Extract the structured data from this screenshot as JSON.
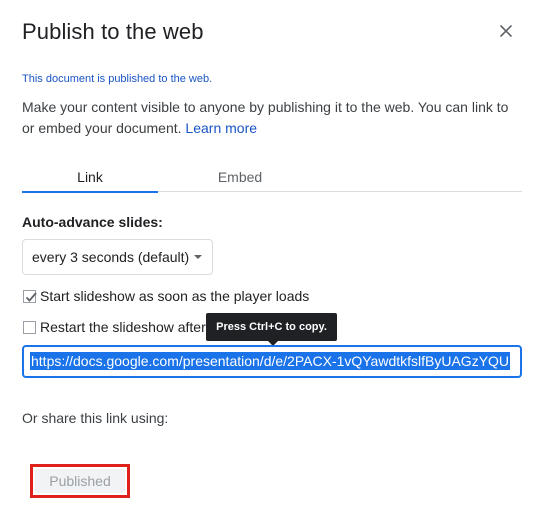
{
  "dialog": {
    "title": "Publish to the web",
    "close_icon": "close-icon",
    "status": "This document is published to the web.",
    "description": "Make your content visible to anyone by publishing it to the web. You can link to or embed your document.",
    "learn_more": "Learn more"
  },
  "tabs": [
    {
      "label": "Link",
      "active": true
    },
    {
      "label": "Embed",
      "active": false
    }
  ],
  "settings": {
    "auto_advance_label": "Auto-advance slides:",
    "auto_advance_value": "every 3 seconds (default)",
    "start_slideshow": {
      "label": "Start slideshow as soon as the player loads",
      "checked": true
    },
    "restart_slideshow": {
      "label": "Restart the slideshow after",
      "checked": false
    }
  },
  "tooltip": "Press Ctrl+C to copy.",
  "url": "https://docs.google.com/presentation/d/e/2PACX-1vQYawdtkfslfByUAGzYQU",
  "share_label": "Or share this link using:",
  "published_button": "Published",
  "colors": {
    "accent": "#1a73e8",
    "link": "#1a55c4",
    "highlight_border": "#e0201b"
  }
}
